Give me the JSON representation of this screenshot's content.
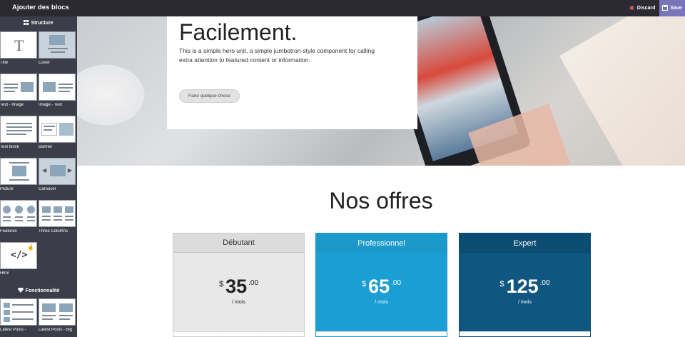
{
  "topbar": {
    "title": "Ajouter des blocs",
    "discard_label": "Discard",
    "save_label": "Save"
  },
  "sidebar": {
    "structure_heading": "Structure",
    "features_heading": "Fonctionnalité",
    "blocks": [
      {
        "label": "Title",
        "icon": "title-block-icon"
      },
      {
        "label": "Cover",
        "icon": "cover-block-icon"
      },
      {
        "label": "Text - Image",
        "icon": "text-image-block-icon"
      },
      {
        "label": "Image - Text",
        "icon": "image-text-block-icon"
      },
      {
        "label": "Text block",
        "icon": "text-block-icon"
      },
      {
        "label": "Banner",
        "icon": "banner-block-icon"
      },
      {
        "label": "Picture",
        "icon": "picture-block-icon"
      },
      {
        "label": "Carousel",
        "icon": "carousel-block-icon"
      },
      {
        "label": "Features",
        "icon": "features-block-icon"
      },
      {
        "label": "Three Columns",
        "icon": "three-columns-block-icon"
      },
      {
        "label": "Html",
        "icon": "html-block-icon"
      }
    ],
    "feature_blocks": [
      {
        "label": "Latest Posts - ",
        "icon": "latest-posts-block-icon"
      },
      {
        "label": "Latest Posts - Big",
        "icon": "latest-posts-big-block-icon"
      }
    ]
  },
  "hero": {
    "title": "Facilement.",
    "description": "This is a simple hero unit, a simple jumbotron-style component for calling extra attention to featured content or information.",
    "cta_label": "Faire quelque chose"
  },
  "pricing": {
    "title": "Nos offres",
    "plans": [
      {
        "name": "Débutant",
        "currency": "$",
        "amount": "35",
        "cents": ".00",
        "period": "/ mois"
      },
      {
        "name": "Professionnel",
        "currency": "$",
        "amount": "65",
        "cents": ".00",
        "period": "/ mois"
      },
      {
        "name": "Expert",
        "currency": "$",
        "amount": "125",
        "cents": ".00",
        "period": "/ mois"
      }
    ]
  },
  "colors": {
    "topbar_bg": "#2b2a33",
    "sidebar_bg": "#3b3d48",
    "save_bg": "#7a75b8",
    "plan_pro": "#1a9ed4",
    "plan_expert": "#0f5680"
  }
}
